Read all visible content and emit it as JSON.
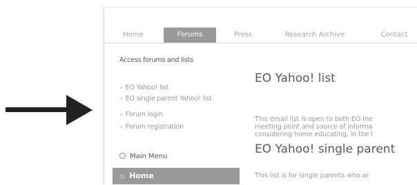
{
  "nav": {
    "tabs": [
      {
        "label": "Home"
      },
      {
        "label": "Forums"
      },
      {
        "label": "Press"
      },
      {
        "label": "Research Archive"
      },
      {
        "label": "Contact"
      }
    ],
    "active_tab": "Forums"
  },
  "sidebar": {
    "title": "Access forums and lists",
    "links": [
      {
        "label": "EO Yahoo! list"
      },
      {
        "label": "EO single parent Yahoo! list"
      },
      {
        "label": "Forum login"
      },
      {
        "label": "Forum registration"
      }
    ],
    "main_menu_label": "Main Menu",
    "home_label": "Home"
  },
  "content": {
    "section1": {
      "title": "EO Yahoo! list",
      "lines": [
        "This email list is open to both EO me",
        "meeting point and source of informa",
        "considering home educating, in the l"
      ]
    },
    "section2": {
      "title": "EO Yahoo! single parent",
      "lines": [
        "This list is for single parents who ar"
      ]
    }
  },
  "colors": {
    "active_tab_bg": "#9a9a9a",
    "home_bar_bg": "#9a9a9a",
    "arrow": "#222222"
  }
}
